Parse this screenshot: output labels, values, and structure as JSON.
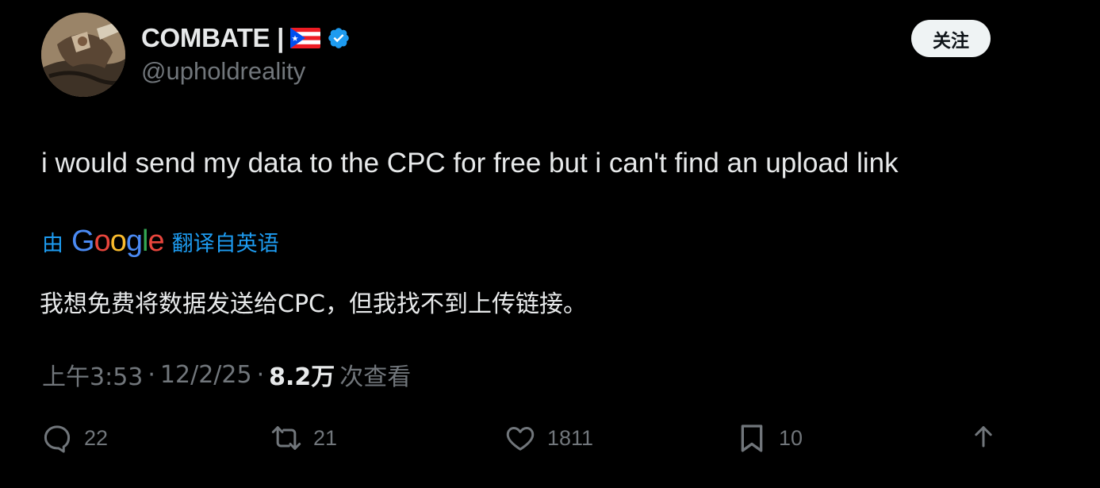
{
  "author": {
    "display_name": "COMBATE |",
    "handle": "@upholdreality"
  },
  "follow_button": {
    "label": "关注"
  },
  "tweet": {
    "text": "i would send my data to the CPC for free but i can't find an upload link"
  },
  "translation": {
    "by_label": "由",
    "google_letters": [
      "G",
      "o",
      "o",
      "g",
      "l",
      "e"
    ],
    "link_label": "翻译自英语",
    "translated_text": "我想免费将数据发送给CPC，但我找不到上传链接。"
  },
  "meta": {
    "time": "上午3:53",
    "separator": "·",
    "date": "12/2/25",
    "views_count": "8.2万",
    "views_label": "次查看"
  },
  "actions": {
    "reply_count": "22",
    "retweet_count": "21",
    "like_count": "1811",
    "bookmark_count": "10"
  },
  "colors": {
    "background": "#000000",
    "text_primary": "#e7e9ea",
    "text_secondary": "#71767b",
    "link_blue": "#1d9bf0",
    "follow_bg": "#eff3f4"
  },
  "icons": {
    "flag": "puerto-rico-flag-icon",
    "verified": "verified-badge-icon",
    "reply": "reply-icon",
    "retweet": "retweet-icon",
    "like": "heart-icon",
    "bookmark": "bookmark-icon",
    "share": "share-icon"
  }
}
